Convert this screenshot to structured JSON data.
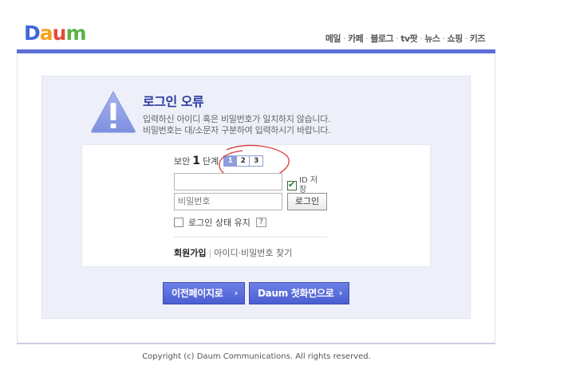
{
  "header": {
    "logo_letters": [
      "D",
      "a",
      "u",
      "m"
    ],
    "logo_colors": [
      "#3f66d9",
      "#f3a21c",
      "#e34a3c",
      "#5ab247"
    ],
    "nav": [
      "메일",
      "카페",
      "블로그",
      "tv팟",
      "뉴스",
      "쇼핑",
      "키즈"
    ],
    "nav_separator": "·",
    "accent": "#5c6fd6"
  },
  "error": {
    "icon": "warning-triangle-icon",
    "title": "로그인 오류",
    "message_line1": "입력하신 아이디 혹은 비밀번호가 일치하지 않습니다.",
    "message_line2": "비밀번호는 대/소문자 구분하여 입력하시기 바랍니다."
  },
  "login": {
    "security_prefix": "보안",
    "security_level": "1",
    "security_suffix": "단계",
    "security_steps": [
      "1",
      "2",
      "3"
    ],
    "security_active": 1,
    "id_value": "",
    "id_save_checked": true,
    "id_save_label": "ID 저장",
    "password_placeholder": "비밀번호",
    "login_button": "로그인",
    "keep_logged_in": "로그인 상태 유지",
    "keep_logged_in_checked": false,
    "help": "?",
    "join": "회원가입",
    "find": "아이디·비밀번호 찾기"
  },
  "buttons": {
    "prev_page": "이전페이지로",
    "daum_home": "Daum 첫화면으로",
    "arrow": "›"
  },
  "footer": {
    "copyright": "Copyright (c) Daum Communications. All rights reserved."
  },
  "annotation": {
    "color": "#d63a3a"
  }
}
